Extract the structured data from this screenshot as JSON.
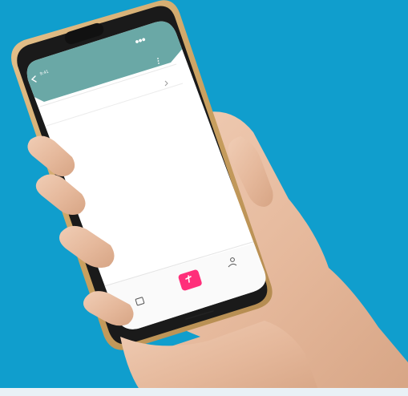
{
  "colors": {
    "background": "#109ecd",
    "app_header": "#6aa8a6",
    "screen": "#ffffff",
    "accent": "#ff2f7a",
    "phone_frame": "#1a1a1a",
    "phone_rim": "#d6ad6a",
    "skin": "#e7c1a6"
  },
  "phone": {
    "status_bar": {
      "time": "9:41",
      "right": "●●●"
    },
    "app": {
      "header_title": "",
      "back_icon": "chevron-left-icon",
      "menu_icon": "kebab-icon",
      "list": [
        {
          "label": ""
        },
        {
          "label": ""
        }
      ],
      "bottom_nav": [
        {
          "icon": "gift-icon",
          "label": ""
        },
        {
          "icon": "action-icon",
          "label": ""
        },
        {
          "icon": "user-icon",
          "label": ""
        }
      ]
    }
  }
}
